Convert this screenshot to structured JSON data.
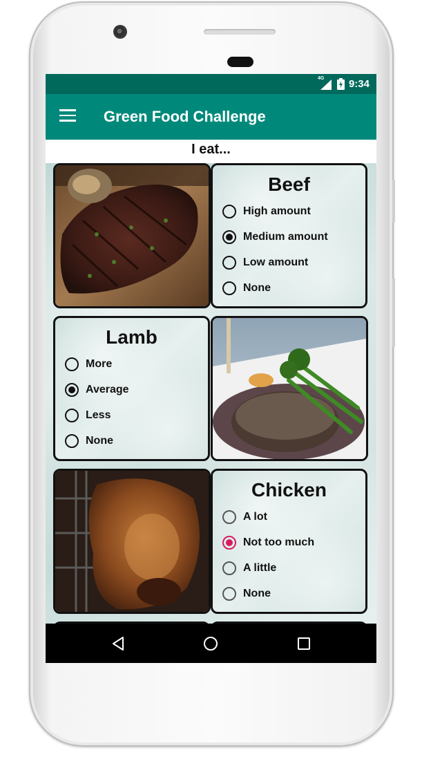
{
  "status_bar": {
    "network": "4G",
    "time": "9:34"
  },
  "app_bar": {
    "title": "Green Food Challenge",
    "menu_icon": "hamburger-menu-icon"
  },
  "section": {
    "heading": "I eat..."
  },
  "questions": {
    "beef": {
      "title": "Beef",
      "options": [
        "High amount",
        "Medium amount",
        "Low amount",
        "None"
      ],
      "selected": "Medium amount"
    },
    "lamb": {
      "title": "Lamb",
      "options": [
        "More",
        "Average",
        "Less",
        "None"
      ],
      "selected": "Average"
    },
    "chicken": {
      "title": "Chicken",
      "options": [
        "A lot",
        "Not too much",
        "A little",
        "None"
      ],
      "selected": "Not too much"
    }
  },
  "images": {
    "beef": "steak-photo",
    "lamb": "lamb-dish-photo",
    "chicken": "roast-chicken-photo"
  },
  "nav_bar": {
    "back": "back-triangle-icon",
    "home": "home-circle-icon",
    "recents": "recents-square-icon"
  },
  "colors": {
    "status_bar": "#00695c",
    "app_bar": "#00897b",
    "accent": "#d81b60"
  }
}
